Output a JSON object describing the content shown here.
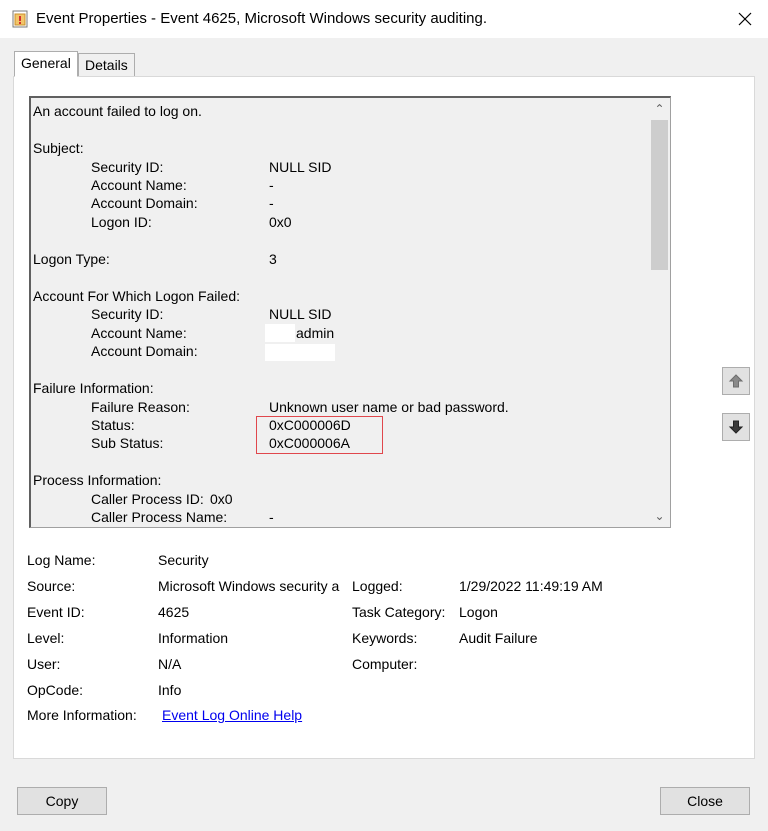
{
  "window": {
    "title": "Event Properties - Event 4625, Microsoft Windows security auditing.",
    "app_icon": "event-viewer-icon",
    "close_icon": "close-icon"
  },
  "tabs": [
    {
      "label": "General",
      "active": true
    },
    {
      "label": "Details",
      "active": false
    }
  ],
  "description": {
    "headline": "An account failed to log on.",
    "subject": {
      "heading": "Subject:",
      "security_id_label": "Security ID:",
      "security_id": "NULL SID",
      "account_name_label": "Account Name:",
      "account_name": "-",
      "account_domain_label": "Account Domain:",
      "account_domain": "-",
      "logon_id_label": "Logon ID:",
      "logon_id": "0x0"
    },
    "logon_type_label": "Logon Type:",
    "logon_type": "3",
    "failed_account": {
      "heading": "Account For Which Logon Failed:",
      "security_id_label": "Security ID:",
      "security_id": "NULL SID",
      "account_name_label": "Account Name:",
      "account_name": "admin",
      "account_domain_label": "Account Domain:"
    },
    "failure": {
      "heading": "Failure Information:",
      "reason_label": "Failure Reason:",
      "reason": "Unknown user name or bad password.",
      "status_label": "Status:",
      "status": "0xC000006D",
      "sub_status_label": "Sub Status:",
      "sub_status": "0xC000006A"
    },
    "process": {
      "heading": "Process Information:",
      "caller_pid_label": "Caller Process ID:",
      "caller_pid": "0x0",
      "caller_name_label": "Caller Process Name:",
      "caller_name": "-"
    },
    "highlight_color": "#e0474c"
  },
  "nav": {
    "up_icon": "arrow-up-icon",
    "down_icon": "arrow-down-icon"
  },
  "meta": {
    "log_name_label": "Log Name:",
    "log_name": "Security",
    "source_label": "Source:",
    "source": "Microsoft Windows security a",
    "logged_label": "Logged:",
    "logged": "1/29/2022 11:49:19 AM",
    "event_id_label": "Event ID:",
    "event_id": "4625",
    "task_category_label": "Task Category:",
    "task_category": "Logon",
    "level_label": "Level:",
    "level": "Information",
    "keywords_label": "Keywords:",
    "keywords": "Audit Failure",
    "user_label": "User:",
    "user": "N/A",
    "computer_label": "Computer:",
    "opcode_label": "OpCode:",
    "opcode": "Info",
    "more_info_label": "More Information:",
    "more_info_link": "Event Log Online Help"
  },
  "buttons": {
    "copy": "Copy",
    "close": "Close"
  }
}
